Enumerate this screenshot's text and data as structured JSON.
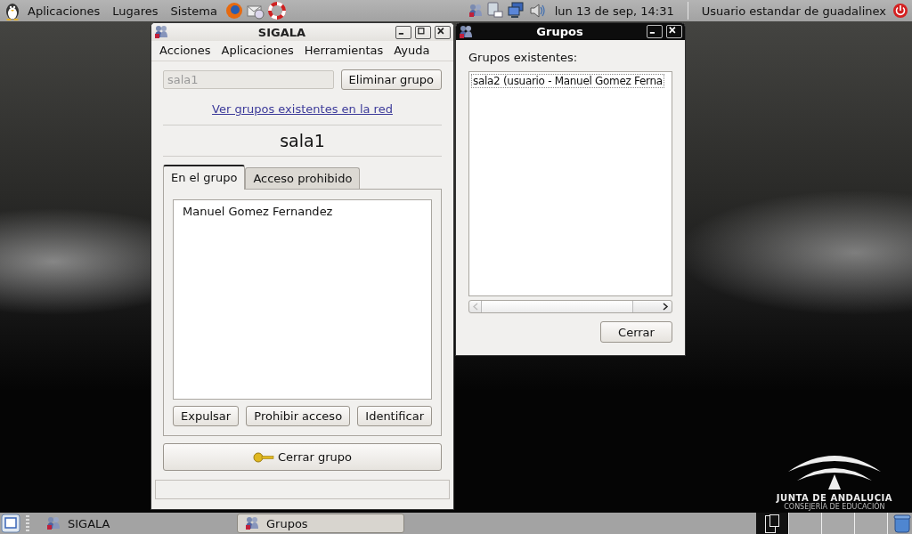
{
  "top_panel": {
    "menus": [
      "Aplicaciones",
      "Lugares",
      "Sistema"
    ],
    "clock": "lun 13 de sep, 14:31",
    "user": "Usuario estandar de guadalinex"
  },
  "sigala_window": {
    "title": "SIGALA",
    "menu": [
      "Acciones",
      "Aplicaciones",
      "Herramientas",
      "Ayuda"
    ],
    "group_field": {
      "value": "sala1",
      "disabled": true
    },
    "delete_button": "Eliminar grupo",
    "network_link": "Ver grupos existentes en la red",
    "group_name": "sala1",
    "tabs": [
      {
        "label": "En el grupo",
        "selected": true
      },
      {
        "label": "Acceso prohibido",
        "selected": false
      }
    ],
    "members": [
      "Manuel Gomez Fernandez"
    ],
    "buttons": [
      "Expulsar",
      "Prohibir acceso",
      "Identificar"
    ],
    "close_group_button": "Cerrar grupo"
  },
  "groups_window": {
    "title": "Grupos",
    "label": "Grupos existentes:",
    "groups": [
      "sala2 (usuario - Manuel Gomez Ferna"
    ],
    "close_button": "Cerrar"
  },
  "wallpaper_logo": {
    "line_1": "JUNTA DE ANDALUCIA",
    "line_2": "CONSEJERÍA DE EDUCACIÓN"
  },
  "taskbar": {
    "tasks": [
      {
        "label": "SIGALA",
        "selected": false
      },
      {
        "label": "Grupos",
        "selected": true
      }
    ],
    "workspaces": [
      {
        "selected": true
      },
      {
        "selected": false
      },
      {
        "selected": false
      },
      {
        "selected": false
      }
    ]
  }
}
